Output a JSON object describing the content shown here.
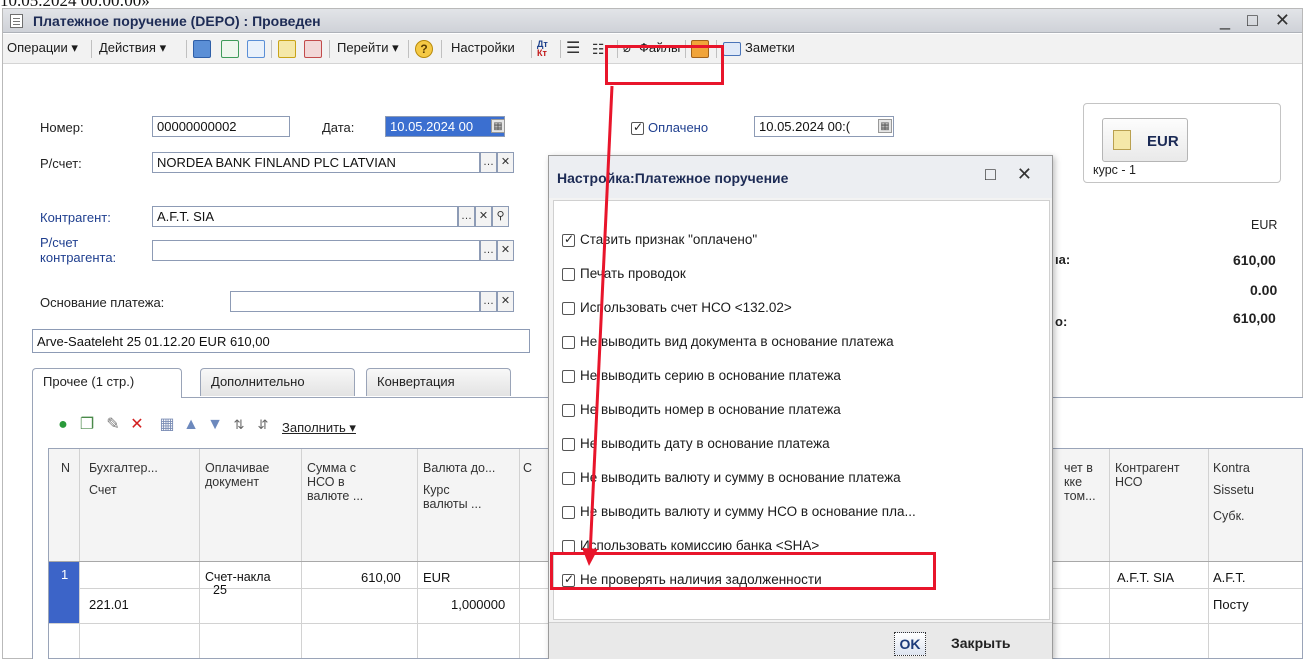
{
  "topline": "10.05.2024 00:00:00»",
  "window": {
    "title": "Платежное поручение (DEPO) : Проведен",
    "controls": "_ □ ✕"
  },
  "toolbar": {
    "operations": "Операции ▾",
    "actions": "Действия ▾",
    "goto": "Перейти ▾",
    "settings": "Настройки",
    "files": "Файлы",
    "notes": "Заметки"
  },
  "form": {
    "number_label": "Номер:",
    "number_value": "00000000002",
    "date_label": "Дата:",
    "date_value": "10.05.2024 00",
    "paid_label": "Оплачено",
    "paid_date": "10.05.2024 00:(",
    "account_label": "Р/счет:",
    "account_value": "NORDEA BANK FINLAND PLC LATVIAN",
    "counterparty_label": "Контрагент:",
    "counterparty_value": "A.F.T. SIA",
    "cp_account_label1": "Р/счет",
    "cp_account_label2": "контрагента:",
    "basis_label": "Основание платежа:",
    "basis_text": "Arve-Saateleht 25 01.12.20 EUR 610,00"
  },
  "currency_panel": {
    "code": "EUR",
    "rate": "курс - 1",
    "col_header": "EUR",
    "label1": "ıa:",
    "label3": "o:",
    "total1": "610,00",
    "total2": "0.00",
    "total3": "610,00"
  },
  "tabs": [
    {
      "label": "Прочее (1 стр.)"
    },
    {
      "label": "Дополнительно"
    },
    {
      "label": "Конвертация"
    }
  ],
  "grid_toolbar": {
    "fill": "Заполнить ▾"
  },
  "grid": {
    "headers": {
      "n": "N",
      "account_top": "Бухгалтер...",
      "account_bottom": "Счет",
      "doc_top": "Оплачивае",
      "doc_bottom": "документ",
      "sum_l1": "Сумма с",
      "sum_l2": "НСО в",
      "sum_l3": "валюте ...",
      "currency_top": "Валюта до...",
      "rate_l1": "Курс",
      "rate_l2": "валюты ...",
      "c_cut": "С",
      "acc_nso_l1": "чет в",
      "acc_nso_l2": "кке",
      "acc_nso_l3": "том...",
      "cp_nso_l1": "Контрагент",
      "cp_nso_l2": "НСО",
      "kontra_l1": "Kontra",
      "kontra_l2": "Sissetu",
      "kontra_l3": "Субк."
    },
    "row": {
      "n": "1",
      "account": "221.01",
      "doc_l1": "Счет-накла",
      "doc_l2": "25",
      "sum": "610,00",
      "currency": "EUR",
      "rate": "1,000000",
      "cp_nso": "A.F.T. SIA",
      "kontra1": "A.F.T.",
      "kontra2": "Посту"
    }
  },
  "dialog": {
    "title": "Настройка:Платежное поручение",
    "controls": "□ ✕",
    "options": [
      {
        "label": "Ставить признак \"оплачено\"",
        "checked": true
      },
      {
        "label": "Печать проводок",
        "checked": false
      },
      {
        "label": "Использовать счет НСО <132.02>",
        "checked": false
      },
      {
        "label": "Не выводить вид документа в основание платежа",
        "checked": false
      },
      {
        "label": "Не выводить серию в основание платежа",
        "checked": false
      },
      {
        "label": "Не выводить номер в основание платежа",
        "checked": false
      },
      {
        "label": "Не выводить дату в основание платежа",
        "checked": false
      },
      {
        "label": "Не выводить валюту и сумму в основание платежа",
        "checked": false
      },
      {
        "label": "Не выводить валюту и сумму НСО в основание пла...",
        "checked": false
      },
      {
        "label": "Использовать комиссию банка <SHA>",
        "checked": false
      },
      {
        "label": "Не проверять наличия задолженности",
        "checked": true
      }
    ],
    "ok": "OK",
    "close": "Закрыть"
  },
  "colors": {
    "highlight": "#e8152b",
    "selection": "#3b6fd0",
    "row_marker": "#3c64c8"
  }
}
